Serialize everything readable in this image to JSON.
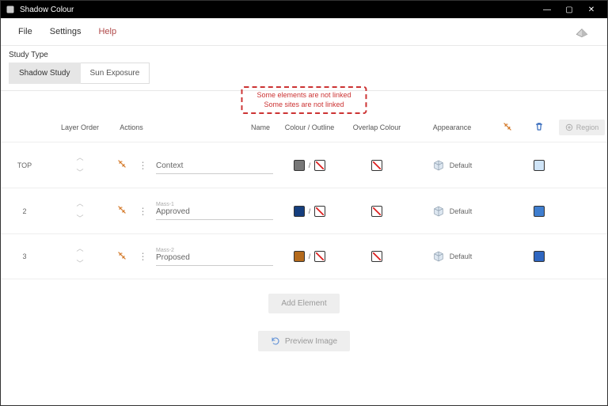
{
  "window": {
    "title": "Shadow Colour"
  },
  "menubar": {
    "file": "File",
    "settings": "Settings",
    "help": "Help"
  },
  "study": {
    "label": "Study Type",
    "tabs": [
      "Shadow Study",
      "Sun Exposure"
    ],
    "active_tab": "Shadow Study"
  },
  "warnings": {
    "line1": "Some elements are not linked",
    "line2": "Some sites are not linked"
  },
  "headers": {
    "layer_order": "Layer Order",
    "actions": "Actions",
    "name": "Name",
    "colour_outline": "Colour / Outline",
    "overlap_colour": "Overlap Colour",
    "appearance": "Appearance",
    "region": "Region"
  },
  "rows": [
    {
      "order": "TOP",
      "sub": "",
      "name": "Context",
      "colour": "#777777",
      "outline": "none",
      "overlap": "none",
      "appearance": "Default",
      "region_colour": "#cfe4f7"
    },
    {
      "order": "2",
      "sub": "Mass-1",
      "name": "Approved",
      "colour": "#153e7e",
      "outline": "none",
      "overlap": "none",
      "appearance": "Default",
      "region_colour": "#3f7ecf"
    },
    {
      "order": "3",
      "sub": "Mass-2",
      "name": "Proposed",
      "colour": "#b46a1c",
      "outline": "none",
      "overlap": "none",
      "appearance": "Default",
      "region_colour": "#2f66c0"
    }
  ],
  "buttons": {
    "add_element": "Add Element",
    "preview_image": "Preview Image"
  }
}
